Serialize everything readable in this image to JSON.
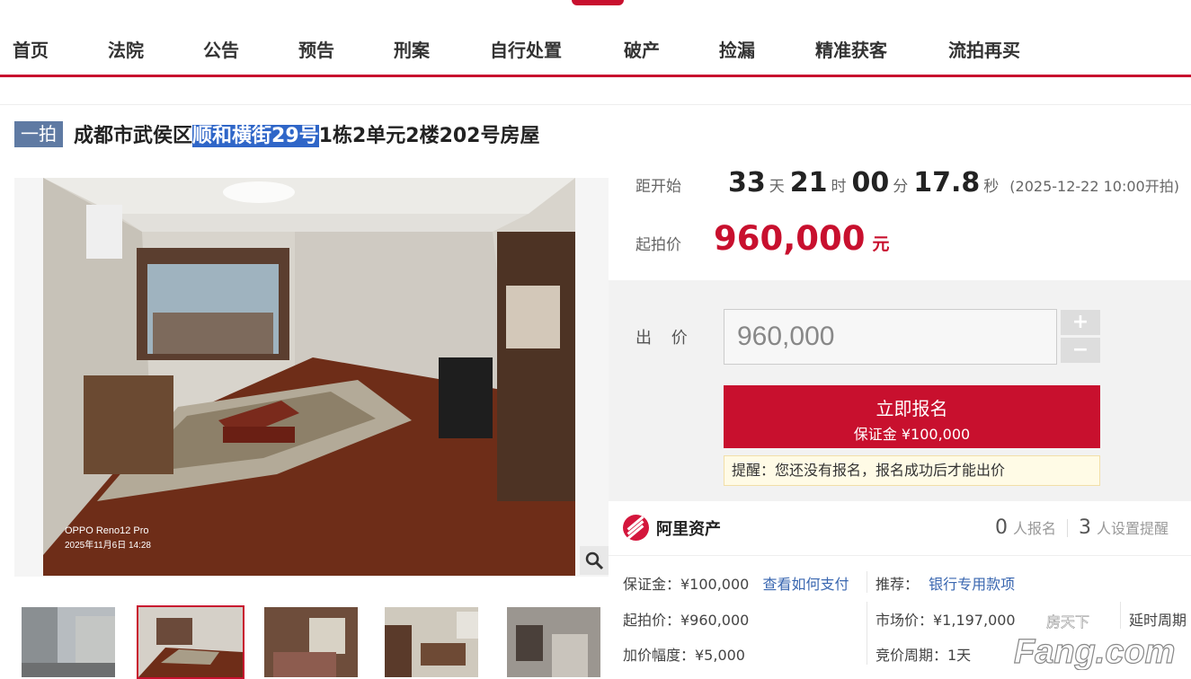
{
  "nav": [
    "首页",
    "法院",
    "公告",
    "预告",
    "刑案",
    "自行处置",
    "破产",
    "捡漏",
    "精准获客",
    "流拍再买"
  ],
  "lot": {
    "tag": "一拍",
    "title_pre": "成都市武侯区",
    "title_hl": "顺和横街29号",
    "title_post": "1栋2单元2楼202号房屋"
  },
  "countdown": {
    "label": "距开始",
    "days": "33",
    "days_unit": "天",
    "hours": "21",
    "hours_unit": "时",
    "minutes": "00",
    "minutes_unit": "分",
    "seconds": "17.8",
    "seconds_unit": "秒",
    "start_note": "(2025-12-22 10:00开拍)"
  },
  "start_price": {
    "label": "起拍价",
    "value": "960,000",
    "unit": "元"
  },
  "bid": {
    "label": "出 价",
    "value": "960,000",
    "plus": "+",
    "minus": "−",
    "signup_main": "立即报名",
    "signup_deposit": "保证金 ¥100,000",
    "reminder": "提醒：您还没有报名，报名成功后才能出价"
  },
  "platform": {
    "name": "阿里资产"
  },
  "stats": {
    "signups": "0",
    "signups_label": "人报名",
    "reminders": "3",
    "reminders_label": "人设置提醒"
  },
  "details": {
    "deposit": "保证金：¥100,000",
    "how_to_pay": "查看如何支付",
    "recommend_label": "推荐：",
    "recommend_link": "银行专用款项",
    "start_price": "起拍价：¥960,000",
    "market_price": "市场价：¥1,197,000",
    "delay": "延时周期",
    "increment": "加价幅度：¥5,000",
    "cycle": "竞价周期：1天"
  },
  "photo_caption": {
    "device": "OPPO Reno12 Pro",
    "time": "2025年11月6日 14:28"
  },
  "watermark": {
    "top": "房天下",
    "main": "Fang.com"
  }
}
